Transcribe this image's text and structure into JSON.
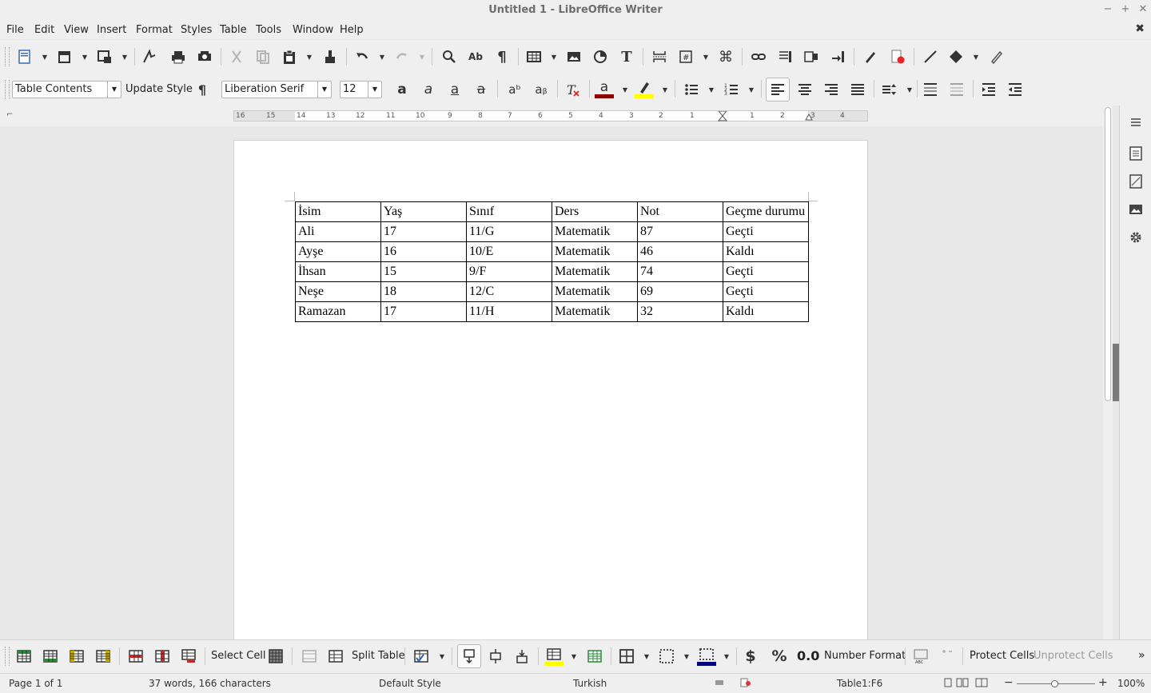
{
  "window": {
    "title": "Untitled 1 - LibreOffice Writer",
    "minimize": "−",
    "maximize": "+",
    "close": "✕"
  },
  "menu": {
    "items": [
      "File",
      "Edit",
      "View",
      "Insert",
      "Format",
      "Styles",
      "Table",
      "Tools",
      "Window",
      "Help"
    ],
    "close_document": "✖"
  },
  "formatting": {
    "paragraph_style": "Table Contents",
    "update_style_label": "Update Style",
    "font_name": "Liberation Serif",
    "font_size": "12",
    "font_color": "#8b0000",
    "highlight_color": "#ffff00"
  },
  "ruler": {
    "labels": [
      "16",
      "15",
      "14",
      "13",
      "12",
      "11",
      "10",
      "9",
      "8",
      "7",
      "6",
      "5",
      "4",
      "3",
      "2",
      "1",
      "1",
      "2",
      "3",
      "4"
    ]
  },
  "document": {
    "table": {
      "rows": [
        [
          "İsim",
          "Yaş",
          "Sınıf",
          "Ders",
          "Not",
          "Geçme durumu"
        ],
        [
          "Ali",
          "17",
          "11/G",
          "Matematik",
          "87",
          "Geçti"
        ],
        [
          "Ayşe",
          "16",
          "10/E",
          "Matematik",
          "46",
          "Kaldı"
        ],
        [
          "İhsan",
          "15",
          "9/F",
          "Matematik",
          "74",
          "Geçti"
        ],
        [
          "Neşe",
          "18",
          "12/C",
          "Matematik",
          "69",
          "Geçti"
        ],
        [
          "Ramazan",
          "17",
          "11/H",
          "Matematik",
          "32",
          "Kaldı"
        ]
      ]
    }
  },
  "table_toolbar": {
    "select_cell": "Select Cell",
    "split_table": "Split Table",
    "decimal_format": "0.0",
    "number_format": "Number Format",
    "protect_cells": "Protect Cells",
    "unprotect_cells": "Unprotect Cells",
    "more": "»"
  },
  "status": {
    "page": "Page 1 of 1",
    "words": "37 words, 166 characters",
    "page_style": "Default Style",
    "language": "Turkish",
    "cell": "Table1:F6",
    "zoom": "100%"
  }
}
